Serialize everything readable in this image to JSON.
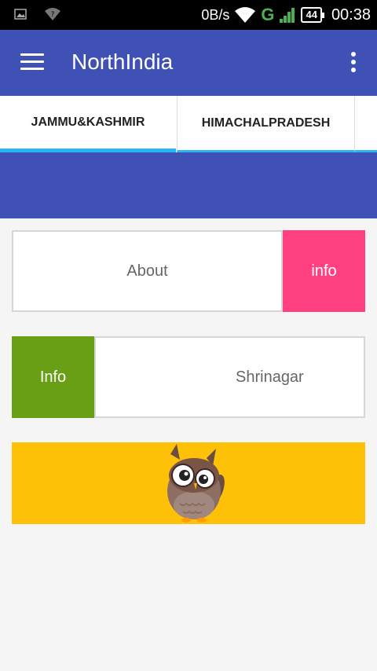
{
  "status_bar": {
    "net_speed": "0B/s",
    "network_type": "G",
    "battery": "44",
    "time": "00:38",
    "icons": [
      "image-icon",
      "wifi-question-icon",
      "wifi-icon",
      "signal-icon",
      "battery-icon"
    ]
  },
  "app_bar": {
    "title": "NorthIndia",
    "icons": [
      "menu-icon",
      "overflow-menu-icon"
    ],
    "color": "#3f51b5"
  },
  "tabs": [
    {
      "label": "JAMMU&KASHMIR",
      "selected": true
    },
    {
      "label": "HIMACHALPRADESH",
      "selected": false
    }
  ],
  "cards": {
    "about": {
      "label": "About",
      "action_label": "info",
      "action_color": "#ff4081"
    },
    "city": {
      "action_label": "Info",
      "label": "Shrinagar",
      "action_color": "#689f14"
    }
  },
  "footer_banner": {
    "color": "#ffc107",
    "image": "owl-illustration"
  }
}
